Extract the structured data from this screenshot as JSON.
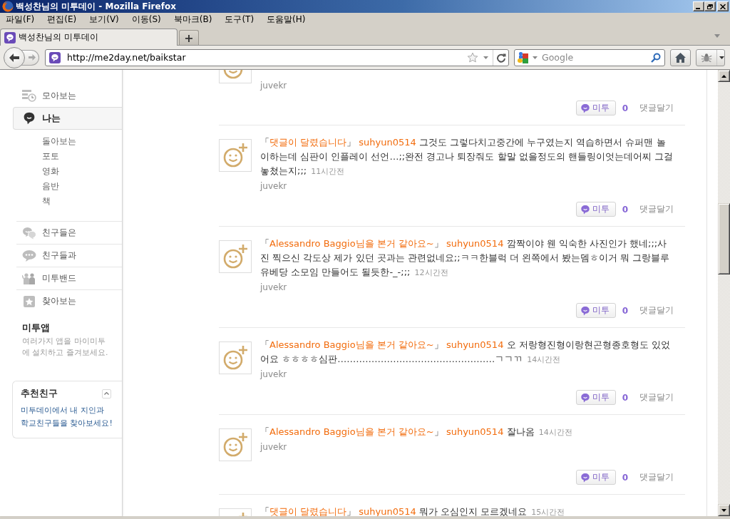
{
  "window": {
    "title": "백성찬님의 미투데이 - Mozilla Firefox"
  },
  "menu_bar": [
    "파일(F)",
    "편집(E)",
    "보기(V)",
    "이동(S)",
    "북마크(B)",
    "도구(T)",
    "도움말(H)"
  ],
  "tabs": [
    {
      "label": "백성찬님의 미투데이",
      "selected": true
    }
  ],
  "new_tab": "+",
  "navigation": {
    "back": {
      "disabled": false
    },
    "forward": {
      "disabled": true
    }
  },
  "address_bar": {
    "url": "http://me2day.net/baikstar"
  },
  "search_bar": {
    "placeholder": "Google"
  },
  "sidebar": {
    "primary_items": [
      {
        "label": "모아보는",
        "selected": false
      },
      {
        "label": "나는",
        "selected": true,
        "children": [
          {
            "label": "돌아보는",
            "selected": false
          },
          {
            "label": "포토",
            "selected": false
          },
          {
            "label": "영화",
            "selected": false
          },
          {
            "label": "음반",
            "selected": false
          },
          {
            "label": "책",
            "selected": false
          }
        ]
      }
    ],
    "secondary_items": [
      {
        "label": "친구들은",
        "selected": false
      },
      {
        "label": "친구들과",
        "selected": false
      },
      {
        "label": "미투밴드",
        "selected": false
      },
      {
        "label": "찾아보는",
        "selected": false
      }
    ],
    "app_section": {
      "title": "미투앱",
      "description": "여러가지 앱을 마이미투에 설치하고 즐겨보세요."
    },
    "recommend_card": {
      "title": "추천친구",
      "expanded": true,
      "link": "미투데이에서 내 지인과 학교친구들을 찾아보세요!"
    }
  },
  "posts": [
    {
      "author": "juvekr",
      "metoo_label": "미투",
      "metoo_count": "0",
      "comment_label": "댓글달기"
    },
    {
      "tag_open": "「",
      "tag": "댓글이 달렸습니다",
      "tag_close": "」",
      "user": "suhyun0514",
      "body": "그것도 그렇다치고중간에 누구였는지 역습하면서 슈퍼맨 놀이하는데 심판이 인플레이 선언…;;완전 경고나 퇴장줘도 할말 없을정도의 핸들링이엇는데어찌 그걸 놓쳤는지;;;",
      "time": "11시간전",
      "author": "juvekr",
      "metoo_label": "미투",
      "metoo_count": "0",
      "comment_label": "댓글달기"
    },
    {
      "tag_open": "「",
      "tag": "Alessandro Baggio님을 본거 같아요~",
      "tag_close": "」",
      "user": "suhyun0514",
      "body": "깜짝이야 웬 익숙한 사진인가 했네;;;사진 찍으신 각도상 제가 있던 곳과는 관련없네요;;ㅋㅋ한블럭 더 왼쪽에서 봤는뎀ㅎ이거 뭐 그랑블루 유베당 소모임 만들어도 될듯한-_-;;;",
      "time": "12시간전",
      "author": "juvekr",
      "metoo_label": "미투",
      "metoo_count": "0",
      "comment_label": "댓글달기"
    },
    {
      "tag_open": "「",
      "tag": "Alessandro Baggio님을 본거 같아요~",
      "tag_close": "」",
      "user": "suhyun0514",
      "body": "오 저랑형진형이랑현곤형종호형도 있었어요 ㅎㅎㅎㅎ심판……………………………………………ㄱㄱㄲ",
      "time": "14시간전",
      "author": "juvekr",
      "metoo_label": "미투",
      "metoo_count": "0",
      "comment_label": "댓글달기"
    },
    {
      "tag_open": "「",
      "tag": "Alessandro Baggio님을 본거 같아요~",
      "tag_close": "」",
      "user": "suhyun0514",
      "body": "잘나옴",
      "time": "14시간전",
      "author": "juvekr",
      "metoo_label": "미투",
      "metoo_count": "0",
      "comment_label": "댓글달기"
    },
    {
      "tag_open": "「",
      "tag": "댓글이 달렸습니다",
      "tag_close": "」",
      "user": "suhyun0514",
      "body": "뭐가 오심인지 모르겠네요",
      "time": "15시간전"
    }
  ]
}
